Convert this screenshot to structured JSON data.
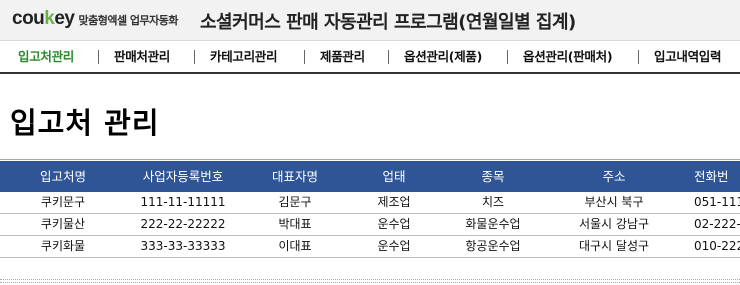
{
  "header": {
    "logo_part1": "cou",
    "logo_part2": "k",
    "logo_part3": "ey",
    "logo_sub": "맞춤형엑셀 업무자동화",
    "title": "소셜커머스 판매 자동관리 프로그램(연월일별 집계)"
  },
  "menu": {
    "items": [
      {
        "label": "입고처관리",
        "active": true
      },
      {
        "label": "판매처관리"
      },
      {
        "label": "카테고리관리"
      },
      {
        "label": "제품관리"
      },
      {
        "label": "옵션관리(제품)"
      },
      {
        "label": "옵션관리(판매처)"
      },
      {
        "label": "입고내역입력"
      }
    ]
  },
  "page": {
    "title": "입고처 관리"
  },
  "table": {
    "columns": [
      "입고처명",
      "사업자등록번호",
      "대표자명",
      "업태",
      "종목",
      "주소",
      "전화번"
    ],
    "rows": [
      [
        "쿠키문구",
        "111-11-11111",
        "김문구",
        "제조업",
        "치즈",
        "부산시 북구",
        "051-111"
      ],
      [
        "쿠키물산",
        "222-22-22222",
        "박대표",
        "운수업",
        "화물운수업",
        "서울시 강남구",
        "02-222-"
      ],
      [
        "쿠키화물",
        "333-33-33333",
        "이대표",
        "운수업",
        "항공운수업",
        "대구시 달성구",
        "010-222"
      ]
    ]
  },
  "colors": {
    "header_bg": "#2f5597",
    "active_menu": "#2a8a2a"
  }
}
